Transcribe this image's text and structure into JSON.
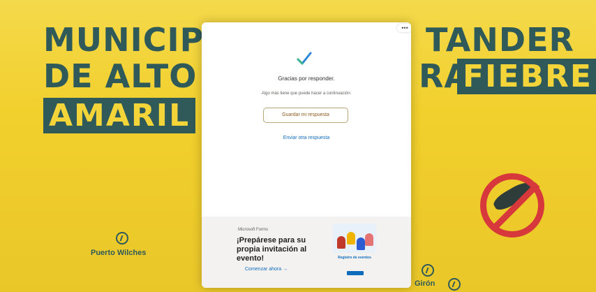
{
  "poster": {
    "line1_start": "MUNICIP",
    "line1_end": "TANDER",
    "line2_start": "DE ALTO",
    "line2_mid": "RA",
    "line2_highlight": "FIEBRE",
    "line3_highlight": "AMARIL",
    "towns": [
      "Puerto Wilches",
      "Girón"
    ],
    "accent_color": "#2f5a59",
    "background_color": "#f1cf2c",
    "sign_color": "#d6383b"
  },
  "dialog": {
    "close_label": "•••",
    "icon": "check-icon",
    "title": "Gracias por responder.",
    "subtitle": "Algo más tiene que puede hacer a continuación:",
    "save_button": "Guardar mi respuesta",
    "another_response_link": "Enviar otra respuesta"
  },
  "promo": {
    "brand": "Microsoft Forms",
    "title": "¡Prepárese para su propia invitación al evento!",
    "cta_link": "Comenzar ahora →",
    "image_caption": "Registro de eventos"
  }
}
